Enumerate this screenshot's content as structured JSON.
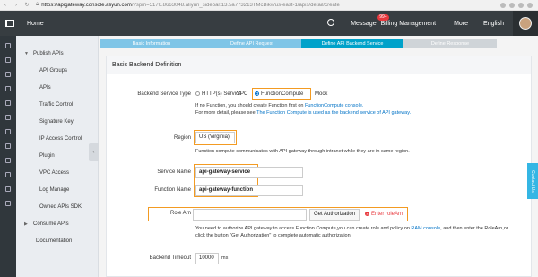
{
  "browser": {
    "url_host": "https://apigateway.console.aliyun.com",
    "url_rest": "/?spm=5176.8663048.aliyun_sidebar.13.5a773213TMcBik#/us-east-1/apis/detail/create"
  },
  "topbar": {
    "home": "Home",
    "message": "Message",
    "message_badge": "99+",
    "billing": "Billing Management",
    "more": "More",
    "language": "English"
  },
  "sidebar": {
    "items": [
      {
        "label": "Publish APIs",
        "caret": "▼"
      },
      {
        "label": "API Groups"
      },
      {
        "label": "APIs"
      },
      {
        "label": "Traffic Control"
      },
      {
        "label": "Signature Key"
      },
      {
        "label": "IP Access Control"
      },
      {
        "label": "Plugin"
      },
      {
        "label": "VPC Access"
      },
      {
        "label": "Log Manage"
      },
      {
        "label": "Owned APIs SDK"
      },
      {
        "label": "Consume APIs",
        "caret": "▶"
      },
      {
        "label": "Documentation"
      }
    ]
  },
  "steps": [
    "Basic Information",
    "Define API Request",
    "Define API Backend Service",
    "Define Response"
  ],
  "panel": {
    "title": "Basic Backend Definition",
    "backend_type_label": "Backend Service Type",
    "options": [
      "HTTP(s) Service",
      "VPC",
      "FunctionCompute",
      "Mock"
    ],
    "fc_note_1_prefix": "If no Function, you should create Function first on ",
    "fc_note_1_link": "FunctionCompute console.",
    "fc_note_2_prefix": "For more detail, please see ",
    "fc_note_2_link": "The Function Compute is used as the backend service of API gateway.",
    "region_label": "Region",
    "region_value": "US (Virginia)",
    "region_note": "Function compute communicates with API gateway through intranet while they are in same region.",
    "service_label": "Service Name",
    "service_value": "api-gateway-service",
    "function_label": "Function Name",
    "function_value": "api-gateway-function",
    "role_label": "Role Arn",
    "role_value": "",
    "get_auth": "Get Authorization",
    "error": "Enter roleArn",
    "auth_note_1_prefix": "You need to authorize API gateway to access Function Compute,you can create role and policy on ",
    "auth_note_1_link": "RAM console",
    "auth_note_1_suffix": ", and then enter the RoleArn,or",
    "auth_note_2": "click the button \"Get Authorization\" to complete automatic authorization.",
    "timeout_label": "Backend Timeout",
    "timeout_value": "10000",
    "timeout_unit": "ms"
  },
  "contact": "Contact Us",
  "colors": {
    "topbar": "#373d41",
    "active_step": "#00a2ca",
    "highlight": "#f39b22",
    "error": "#e8383d"
  }
}
